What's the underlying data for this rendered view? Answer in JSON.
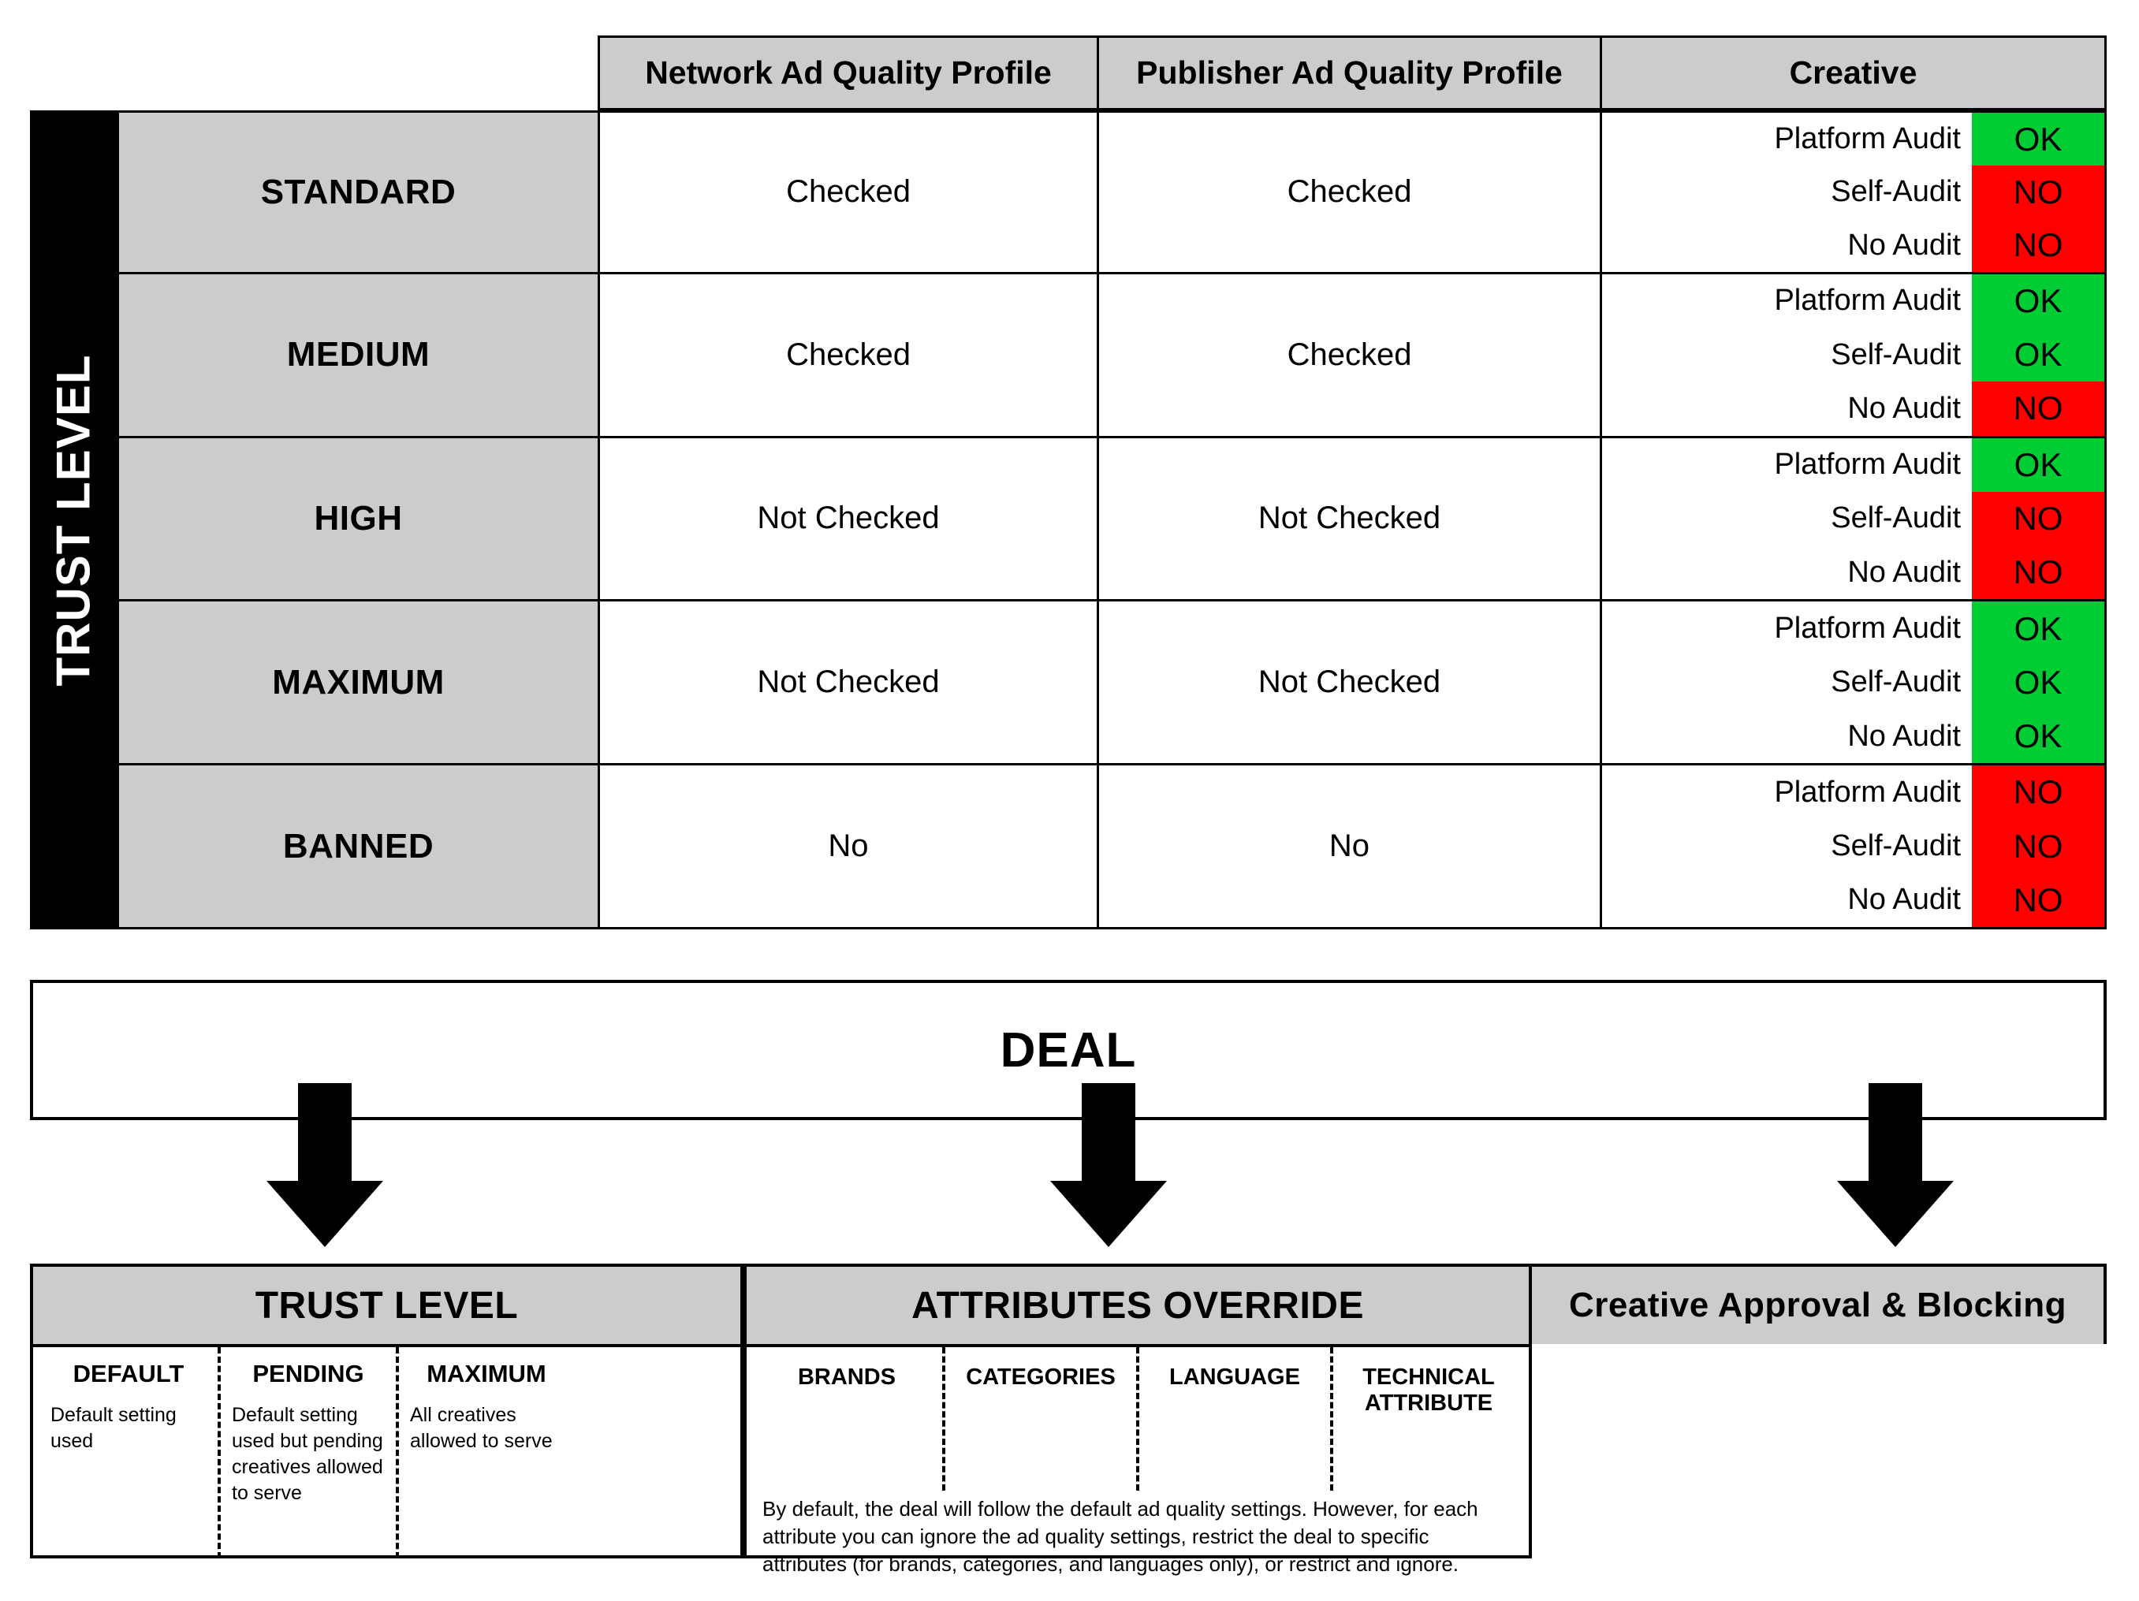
{
  "matrix": {
    "spine_label": "TRUST LEVEL",
    "columns": [
      "Network Ad Quality Profile",
      "Publisher Ad Quality Profile",
      "Creative"
    ],
    "rows": [
      {
        "level": "STANDARD",
        "network": "Checked",
        "publisher": "Checked",
        "creative": [
          {
            "label": "Platform Audit",
            "flag": "OK",
            "state": "ok"
          },
          {
            "label": "Self-Audit",
            "flag": "NO",
            "state": "no"
          },
          {
            "label": "No Audit",
            "flag": "NO",
            "state": "no"
          }
        ]
      },
      {
        "level": "MEDIUM",
        "network": "Checked",
        "publisher": "Checked",
        "creative": [
          {
            "label": "Platform Audit",
            "flag": "OK",
            "state": "ok"
          },
          {
            "label": "Self-Audit",
            "flag": "OK",
            "state": "ok"
          },
          {
            "label": "No Audit",
            "flag": "NO",
            "state": "no"
          }
        ]
      },
      {
        "level": "HIGH",
        "network": "Not Checked",
        "publisher": "Not Checked",
        "creative": [
          {
            "label": "Platform Audit",
            "flag": "OK",
            "state": "ok"
          },
          {
            "label": "Self-Audit",
            "flag": "NO",
            "state": "no"
          },
          {
            "label": "No Audit",
            "flag": "NO",
            "state": "no"
          }
        ]
      },
      {
        "level": "MAXIMUM",
        "network": "Not Checked",
        "publisher": "Not Checked",
        "creative": [
          {
            "label": "Platform Audit",
            "flag": "OK",
            "state": "ok"
          },
          {
            "label": "Self-Audit",
            "flag": "OK",
            "state": "ok"
          },
          {
            "label": "No Audit",
            "flag": "OK",
            "state": "ok"
          }
        ]
      },
      {
        "level": "BANNED",
        "network": "No",
        "publisher": "No",
        "creative": [
          {
            "label": "Platform Audit",
            "flag": "NO",
            "state": "no"
          },
          {
            "label": "Self-Audit",
            "flag": "NO",
            "state": "no"
          },
          {
            "label": "No Audit",
            "flag": "NO",
            "state": "no"
          }
        ]
      }
    ]
  },
  "deal": {
    "title": "DEAL"
  },
  "panels": {
    "trust_level": {
      "title": "TRUST LEVEL",
      "columns": [
        {
          "title": "DEFAULT",
          "desc": "Default setting used"
        },
        {
          "title": "PENDING",
          "desc": "Default setting used but pending creatives allowed to serve"
        },
        {
          "title": "MAXIMUM",
          "desc": "All creatives allowed to serve"
        }
      ]
    },
    "attributes_override": {
      "title": "ATTRIBUTES OVERRIDE",
      "columns": [
        {
          "title": "BRANDS"
        },
        {
          "title": "CATEGORIES"
        },
        {
          "title": "LANGUAGE"
        },
        {
          "title": "TECHNICAL ATTRIBUTE"
        }
      ],
      "note": "By default, the deal will follow the default ad quality settings. However, for each attribute you can ignore the ad quality settings, restrict the deal to specific attributes (for brands, categories, and languages only), or restrict and ignore."
    },
    "creative_approval": {
      "title": "Creative Approval & Blocking"
    }
  },
  "colors": {
    "ok_green": "#00CC33",
    "no_red": "#FF0000",
    "header_gray": "#CCCCCC",
    "spine_black": "#000000"
  }
}
